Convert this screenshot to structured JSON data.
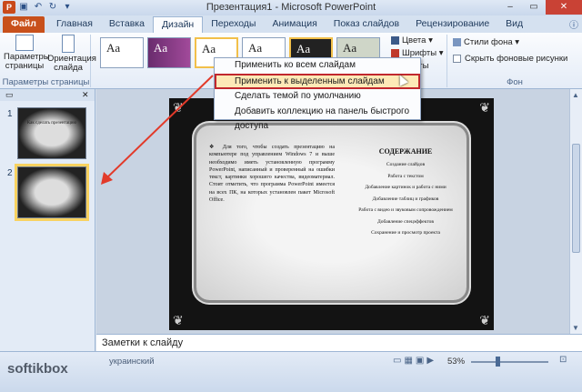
{
  "window": {
    "title": "Презентация1 - Microsoft PowerPoint"
  },
  "tabs": [
    {
      "label": "Файл"
    },
    {
      "label": "Главная"
    },
    {
      "label": "Вставка"
    },
    {
      "label": "Дизайн"
    },
    {
      "label": "Переходы"
    },
    {
      "label": "Анимация"
    },
    {
      "label": "Показ слайдов"
    },
    {
      "label": "Рецензирование"
    },
    {
      "label": "Вид"
    }
  ],
  "ribbon": {
    "page_setup": {
      "page_params_label": "Параметры страницы",
      "orientation_label": "Ориентация слайда",
      "group_label": "Параметры страницы"
    },
    "themes": [
      "Aa",
      "Aa",
      "Aa",
      "Aa",
      "Aa",
      "Aa"
    ],
    "colors_label": "Цвета",
    "fonts_label": "Шрифты",
    "effects_label": "кты",
    "bg_styles_label": "Стили фона",
    "hide_bg_label": "Скрыть фоновые рисунки",
    "bg_group_label": "Фон"
  },
  "menu": {
    "items": [
      {
        "label": "Применить ко всем слайдам"
      },
      {
        "label": "Применить к выделенным слайдам"
      },
      {
        "label": "Сделать темой по умолчанию"
      },
      {
        "label": "Добавить коллекцию на панель быстрого доступа"
      }
    ]
  },
  "slides_pane": {
    "slides": [
      {
        "number": "1",
        "thumb_text": "Как сделать презентацию"
      },
      {
        "number": "2",
        "thumb_text": ""
      }
    ]
  },
  "slide": {
    "body_text": "❖ Для того, чтобы создать презентацию на компьютере под управлением Windows 7 и выше необходимо иметь установленную программу PowerPoint, написанный и проверенный на ошибки текст, картинки хорошего качества, видеоматериал. Стоит отметить, что программа PowerPoint имеется на всех ПК, на которых установлен пакет Microsoft Office.",
    "contents_title": "СОДЕРЖАНИЕ",
    "contents": [
      "Создание слайдов",
      "Работа с текстом",
      "Добавление картинок и работа с ними",
      "Добавление таблиц и графиков",
      "Работа с видео и звуковым сопровождением",
      "Добавление спецэффектов",
      "Сохранение и просмотр проекта"
    ]
  },
  "notes": {
    "placeholder": "Заметки к слайду"
  },
  "status": {
    "watermark": "softikbox",
    "language": "украинский",
    "zoom": "53%"
  }
}
